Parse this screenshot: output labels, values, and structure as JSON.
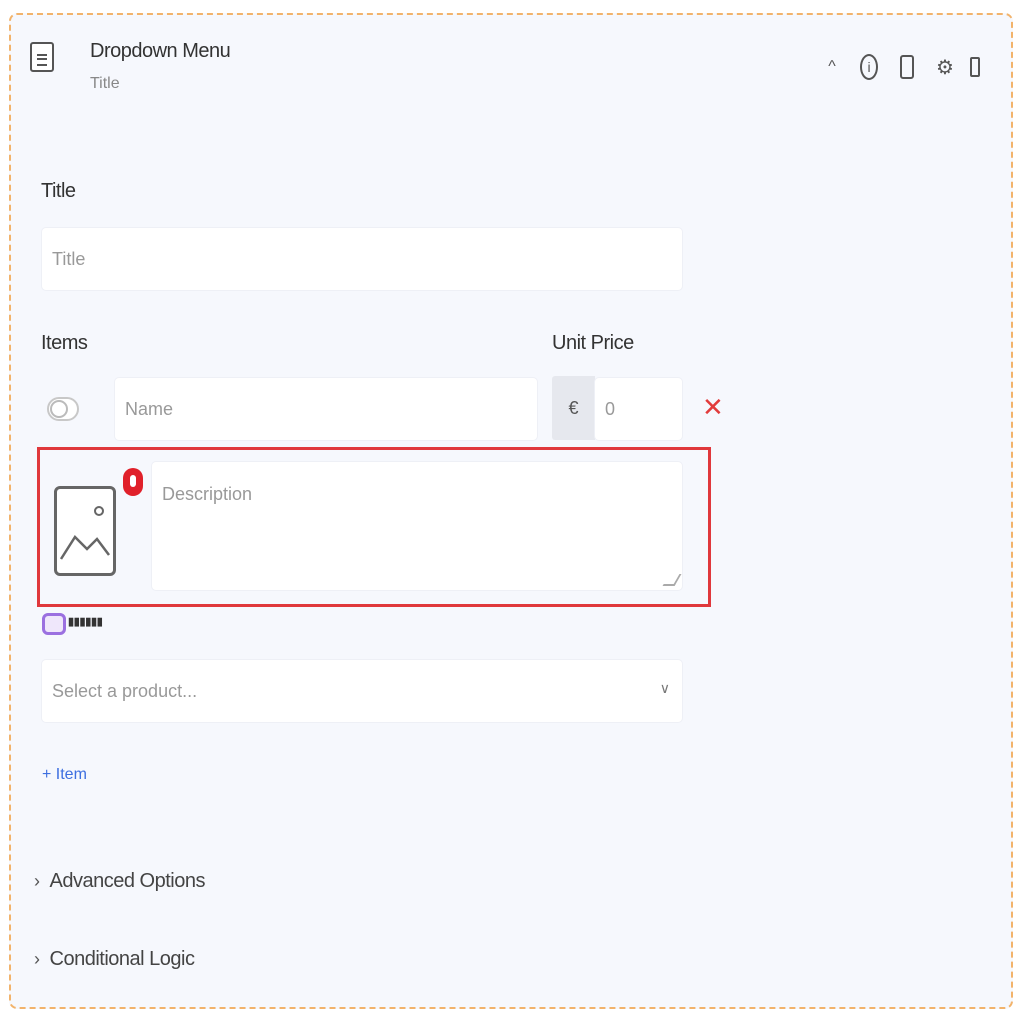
{
  "header": {
    "title": "Dropdown Menu",
    "subtitle": "Title",
    "icons": [
      "document-icon",
      "chevron-up-icon",
      "info-icon",
      "copy-icon",
      "gear-icon",
      "trash-icon"
    ]
  },
  "title_field": {
    "label": "Title",
    "placeholder": "Title"
  },
  "items": {
    "label": "Items",
    "unit_price_label": "Unit Price",
    "name_placeholder": "Name",
    "currency_symbol": "€",
    "price_value": "0",
    "remove_symbol": "✕",
    "description_placeholder": "Description",
    "product_select_placeholder": "Select a product...",
    "add_item_label": "+ Item"
  },
  "sections": {
    "advanced": "Advanced Options",
    "conditional": "Conditional Logic"
  },
  "colors": {
    "card_border": "#f2b36b",
    "card_background": "#f6f8fd",
    "error": "#e0383c",
    "link": "#3d6fe0",
    "logo": "#9b70e0"
  }
}
